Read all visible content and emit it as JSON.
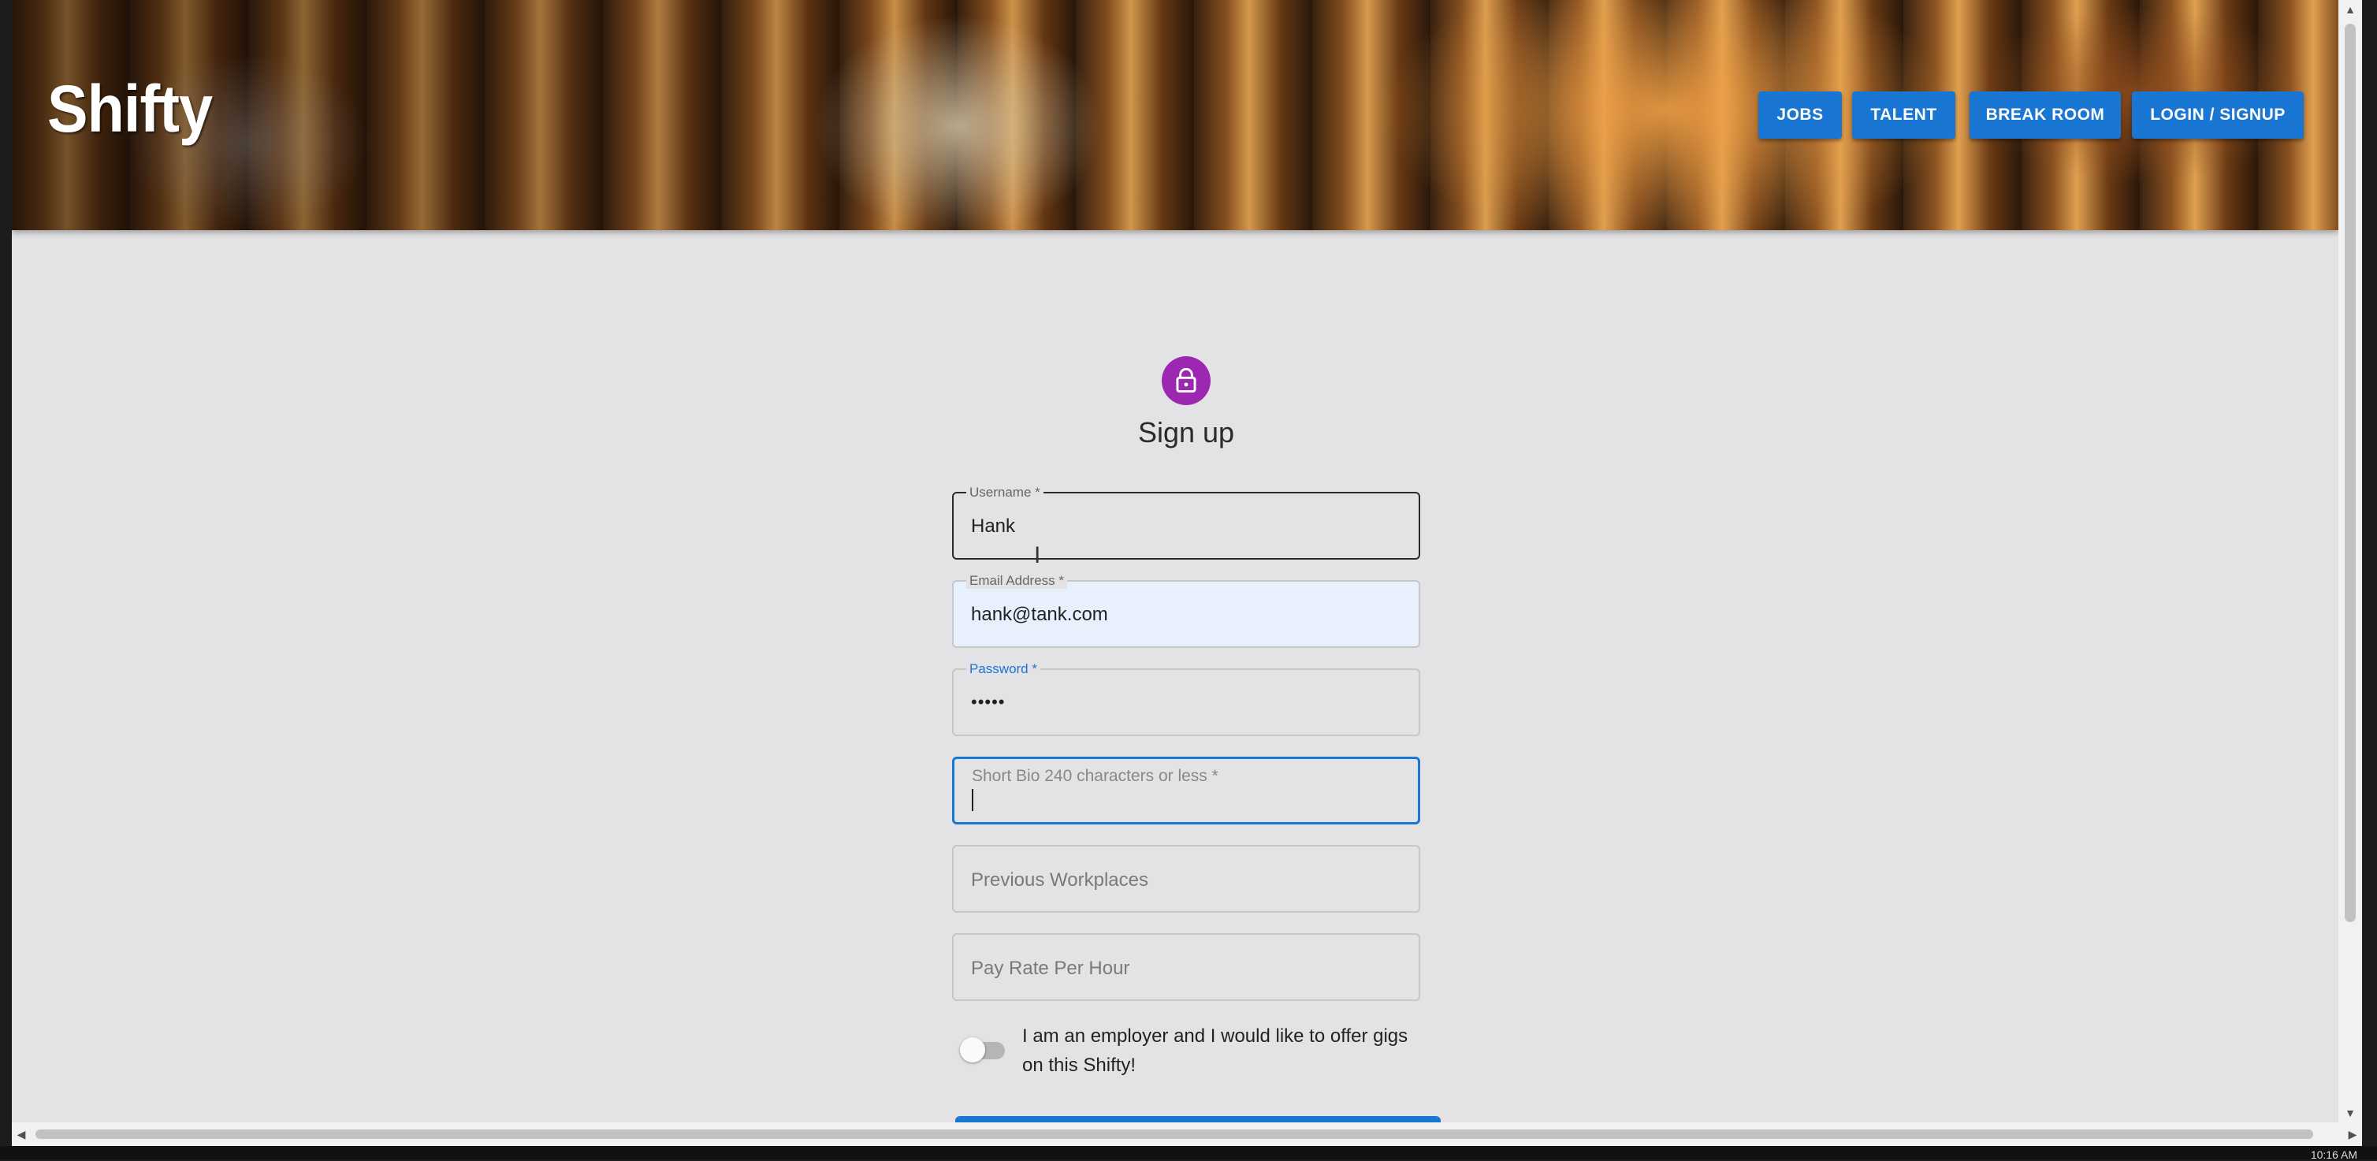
{
  "app": {
    "brand": "Shifty"
  },
  "nav": {
    "items": [
      {
        "label": "JOBS"
      },
      {
        "label": "TALENT"
      },
      {
        "label": "BREAK ROOM"
      },
      {
        "label": "LOGIN / SIGNUP"
      }
    ]
  },
  "form": {
    "title": "Sign up",
    "username": {
      "label": "Username *",
      "value": "Hank"
    },
    "email": {
      "label": "Email Address *",
      "value": "hank@tank.com"
    },
    "password": {
      "label": "Password *",
      "value": "•••••"
    },
    "bio": {
      "label": "Short Bio 240 characters or less *",
      "value": ""
    },
    "workplaces": {
      "placeholder": "Previous Workplaces"
    },
    "pay_rate": {
      "placeholder": "Pay Rate Per Hour"
    },
    "employer_toggle": {
      "label": "I am an employer and I would like to offer gigs on this Shifty!",
      "checked": false
    }
  },
  "system": {
    "clock": "10:16 AM"
  },
  "colors": {
    "primary": "#1976d2",
    "avatar": "#9c27b0",
    "background": "#e3e2e4",
    "focus": "#1976d2",
    "autofill": "#e8f0fe"
  }
}
